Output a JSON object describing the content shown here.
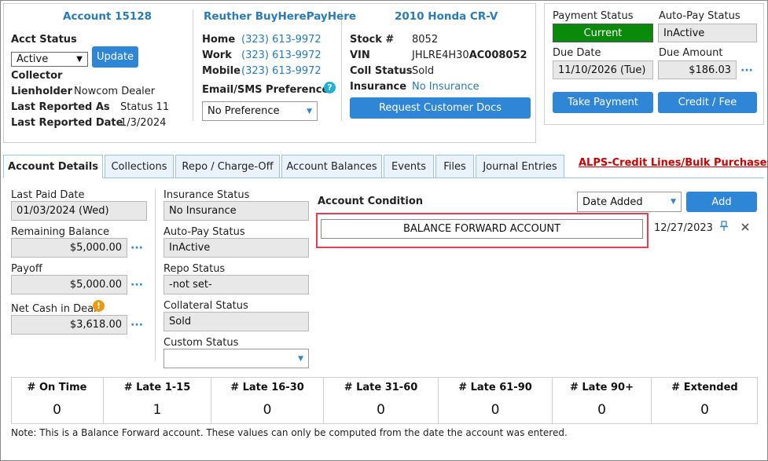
{
  "account": {
    "title": "Account 15128",
    "acct_status_label": "Acct Status",
    "acct_status_value": "Active",
    "update_label": "Update",
    "collector_label": "Collector",
    "lienholder_label": "Lienholder",
    "lienholder_value": "Nowcom Dealer",
    "last_reported_as_label": "Last Reported As",
    "last_reported_as_value": "Status 11",
    "last_reported_date_label": "Last Reported Date",
    "last_reported_date_value": "1/3/2024"
  },
  "customer": {
    "title": "Reuther BuyHerePayHere",
    "home_label": "Home",
    "home_value": "(323) 613-9972",
    "work_label": "Work",
    "work_value": "(323) 613-9972",
    "mobile_label": "Mobile",
    "mobile_value": "(323) 613-9972",
    "pref_label": "Email/SMS Preference",
    "pref_value": "No Preference"
  },
  "vehicle": {
    "title": "2010 Honda CR-V",
    "stock_label": "Stock #",
    "stock_value": "8052",
    "vin_label": "VIN",
    "vin_prefix": "JHLRE4H30",
    "vin_suffix": "AC008052",
    "coll_status_label": "Coll Status",
    "coll_status_value": "Sold",
    "insurance_label": "Insurance",
    "insurance_value": "No Insurance",
    "request_docs_label": "Request Customer Docs"
  },
  "payment": {
    "payment_status_label": "Payment Status",
    "payment_status_value": "Current",
    "autopay_label": "Auto-Pay Status",
    "autopay_value": "InActive",
    "due_date_label": "Due Date",
    "due_date_value": "11/10/2026 (Tue)",
    "due_amount_label": "Due Amount",
    "due_amount_value": "$186.03",
    "take_payment_label": "Take Payment",
    "credit_fee_label": "Credit / Fee",
    "status_color": "#0a8a0a"
  },
  "tabs": [
    {
      "label": "Account Details"
    },
    {
      "label": "Collections"
    },
    {
      "label": "Repo / Charge-Off"
    },
    {
      "label": "Account Balances"
    },
    {
      "label": "Events"
    },
    {
      "label": "Files"
    },
    {
      "label": "Journal Entries"
    }
  ],
  "alps_link": "ALPS-Credit Lines/Bulk Purchases",
  "details": {
    "last_paid_label": "Last Paid Date",
    "last_paid_value": "01/03/2024 (Wed)",
    "remaining_label": "Remaining Balance",
    "remaining_value": "$5,000.00",
    "payoff_label": "Payoff",
    "payoff_value": "$5,000.00",
    "net_cash_label": "Net Cash in Deal",
    "net_cash_value": "$3,618.00",
    "insurance_status_label": "Insurance Status",
    "insurance_status_value": "No Insurance",
    "autopay_status_label": "Auto-Pay Status",
    "autopay_status_value": "InActive",
    "repo_status_label": "Repo Status",
    "repo_status_value": "-not set-",
    "collateral_label": "Collateral Status",
    "collateral_value": "Sold",
    "custom_status_label": "Custom Status",
    "custom_status_value": ""
  },
  "condition": {
    "title": "Account Condition",
    "sort_value": "Date Added",
    "add_label": "Add",
    "entry_text": "BALANCE FORWARD ACCOUNT",
    "entry_date": "12/27/2023"
  },
  "stats": [
    {
      "label": "# On Time",
      "value": "0"
    },
    {
      "label": "# Late 1-15",
      "value": "1"
    },
    {
      "label": "# Late 16-30",
      "value": "0"
    },
    {
      "label": "# Late 31-60",
      "value": "0"
    },
    {
      "label": "# Late 61-90",
      "value": "0"
    },
    {
      "label": "# Late 90+",
      "value": "0"
    },
    {
      "label": "# Extended",
      "value": "0"
    }
  ],
  "note": "Note: This is a Balance Forward account. These values can only be computed from the date the account was entered.",
  "colors": {
    "accent": "#2f86d6",
    "link_red": "#cc0000",
    "highlight_border": "#e04050"
  }
}
